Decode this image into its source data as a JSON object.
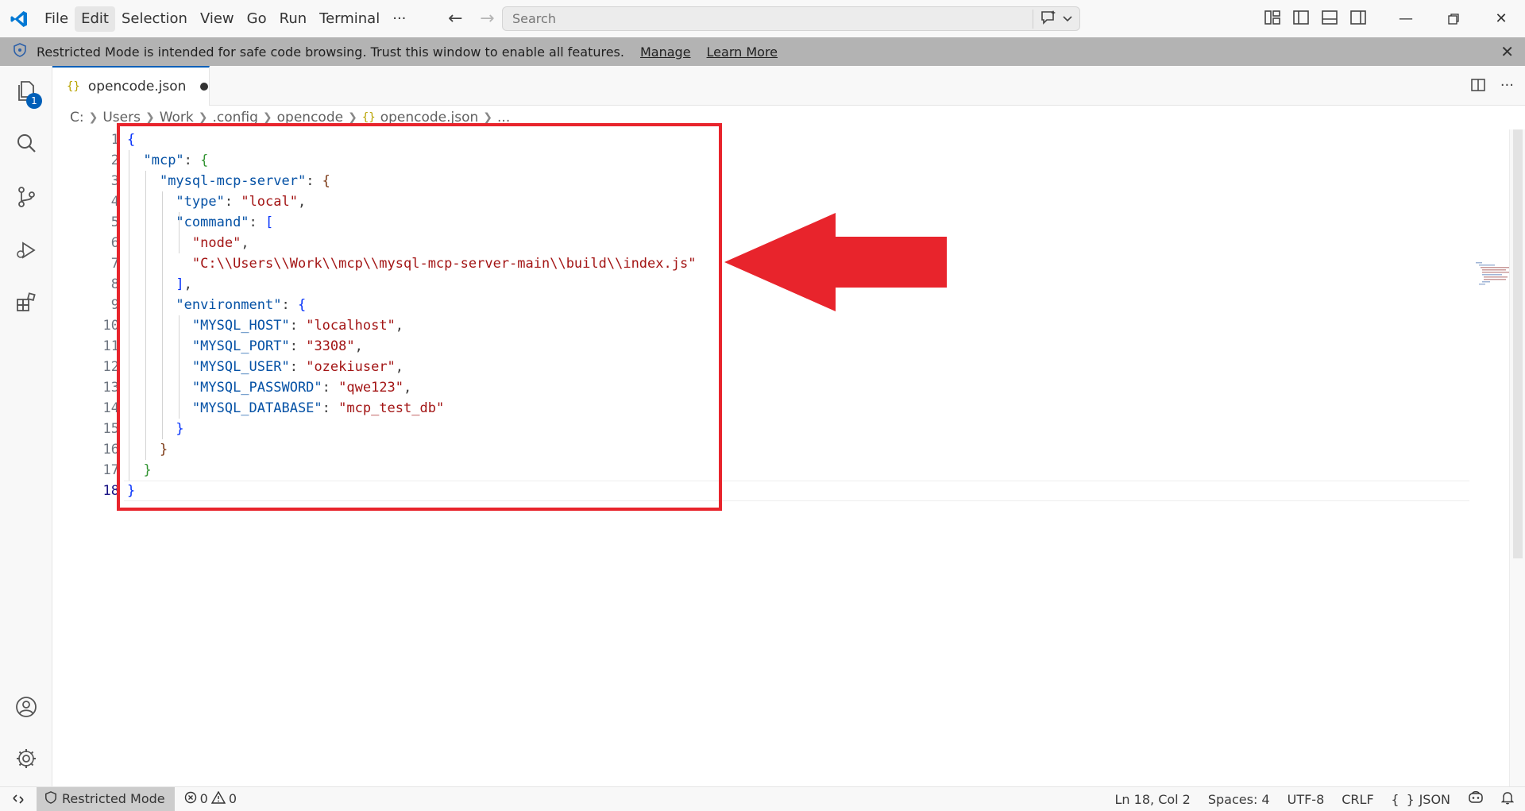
{
  "menu": {
    "items": [
      "File",
      "Edit",
      "Selection",
      "View",
      "Go",
      "Run",
      "Terminal",
      "···"
    ]
  },
  "search": {
    "placeholder": "Search"
  },
  "banner": {
    "text": "Restricted Mode is intended for safe code browsing. Trust this window to enable all features.",
    "manage": "Manage",
    "learn_more": "Learn More"
  },
  "activity": {
    "explorer_badge": "1"
  },
  "tab": {
    "label": "opencode.json",
    "icon": "{}"
  },
  "breadcrumb": {
    "items": [
      "C:",
      "Users",
      "Work",
      ".config",
      "opencode"
    ],
    "file": "opencode.json",
    "ellipsis": "..."
  },
  "editor": {
    "line_numbers": [
      "1",
      "2",
      "3",
      "4",
      "5",
      "6",
      "7",
      "8",
      "9",
      "10",
      "11",
      "12",
      "13",
      "14",
      "15",
      "16",
      "17",
      "18"
    ],
    "active_line": "18"
  },
  "status": {
    "mode": "Restricted Mode",
    "errors": "0",
    "warnings": "0",
    "position": "Ln 18, Col 2",
    "spaces": "Spaces: 4",
    "encoding": "UTF-8",
    "eol": "CRLF",
    "language": "JSON",
    "language_icon": "{ }"
  },
  "colors": {
    "accent": "#005fb8",
    "highlight_box": "#e8242c",
    "arrow": "#e8242c"
  }
}
